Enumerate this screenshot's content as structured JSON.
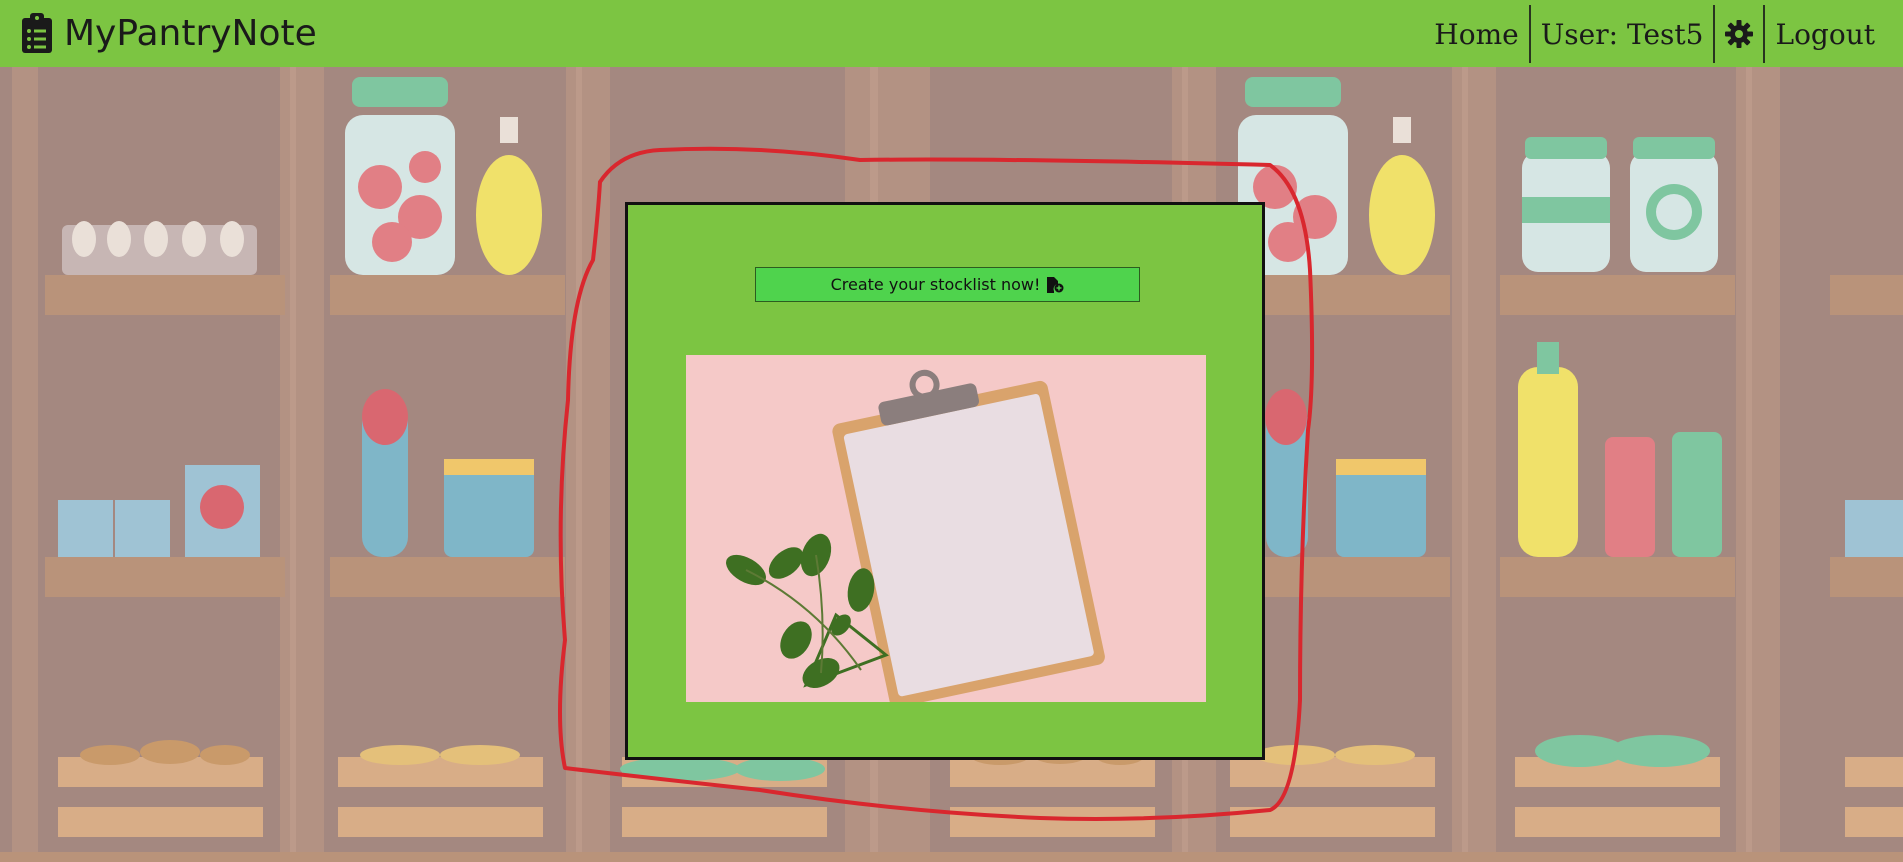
{
  "navbar": {
    "brand": "MyPantryNote",
    "links": {
      "home": "Home",
      "user": "User: Test5",
      "logout": "Logout"
    },
    "brand_color": "#7cc542"
  },
  "modal": {
    "create_button_label": "Create your stocklist now!"
  },
  "icons": {
    "brand": "clipboard-list-icon",
    "settings": "gear-icon",
    "create": "file-plus-icon"
  },
  "colors": {
    "navbar": "#7cc542",
    "card": "#7cc542",
    "button": "#4fd34d",
    "annotation": "#d9272e",
    "background": "#a48880"
  }
}
